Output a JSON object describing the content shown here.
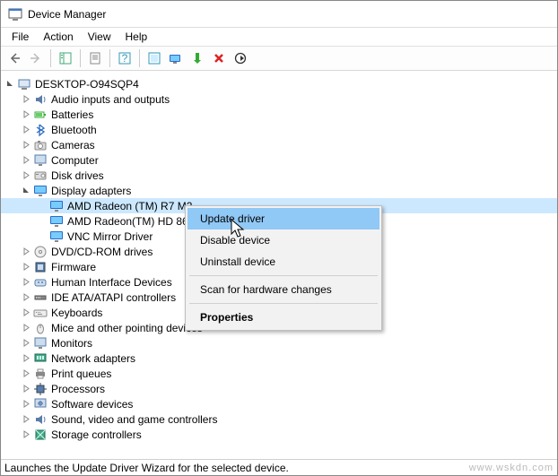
{
  "window": {
    "title": "Device Manager"
  },
  "menu": {
    "file": "File",
    "action": "Action",
    "view": "View",
    "help": "Help"
  },
  "root": {
    "name": "DESKTOP-O94SQP4"
  },
  "categories": [
    {
      "label": "Audio inputs and outputs",
      "expanded": false
    },
    {
      "label": "Batteries",
      "expanded": false
    },
    {
      "label": "Bluetooth",
      "expanded": false
    },
    {
      "label": "Cameras",
      "expanded": false
    },
    {
      "label": "Computer",
      "expanded": false
    },
    {
      "label": "Disk drives",
      "expanded": false
    },
    {
      "label": "Display adapters",
      "expanded": true,
      "children": [
        {
          "label": "AMD Radeon (TM) R7 M2…",
          "selected": true
        },
        {
          "label": "AMD Radeon(TM) HD 861…"
        },
        {
          "label": "VNC Mirror Driver"
        }
      ]
    },
    {
      "label": "DVD/CD-ROM drives",
      "expanded": false
    },
    {
      "label": "Firmware",
      "expanded": false
    },
    {
      "label": "Human Interface Devices",
      "expanded": false
    },
    {
      "label": "IDE ATA/ATAPI controllers",
      "expanded": false
    },
    {
      "label": "Keyboards",
      "expanded": false
    },
    {
      "label": "Mice and other pointing devices",
      "expanded": false
    },
    {
      "label": "Monitors",
      "expanded": false
    },
    {
      "label": "Network adapters",
      "expanded": false
    },
    {
      "label": "Print queues",
      "expanded": false
    },
    {
      "label": "Processors",
      "expanded": false
    },
    {
      "label": "Software devices",
      "expanded": false
    },
    {
      "label": "Sound, video and game controllers",
      "expanded": false
    },
    {
      "label": "Storage controllers",
      "expanded": false
    }
  ],
  "context_menu": {
    "update": "Update driver",
    "disable": "Disable device",
    "uninstall": "Uninstall device",
    "scan": "Scan for hardware changes",
    "properties": "Properties"
  },
  "status": "Launches the Update Driver Wizard for the selected device.",
  "watermark": "www.wskdn.com"
}
